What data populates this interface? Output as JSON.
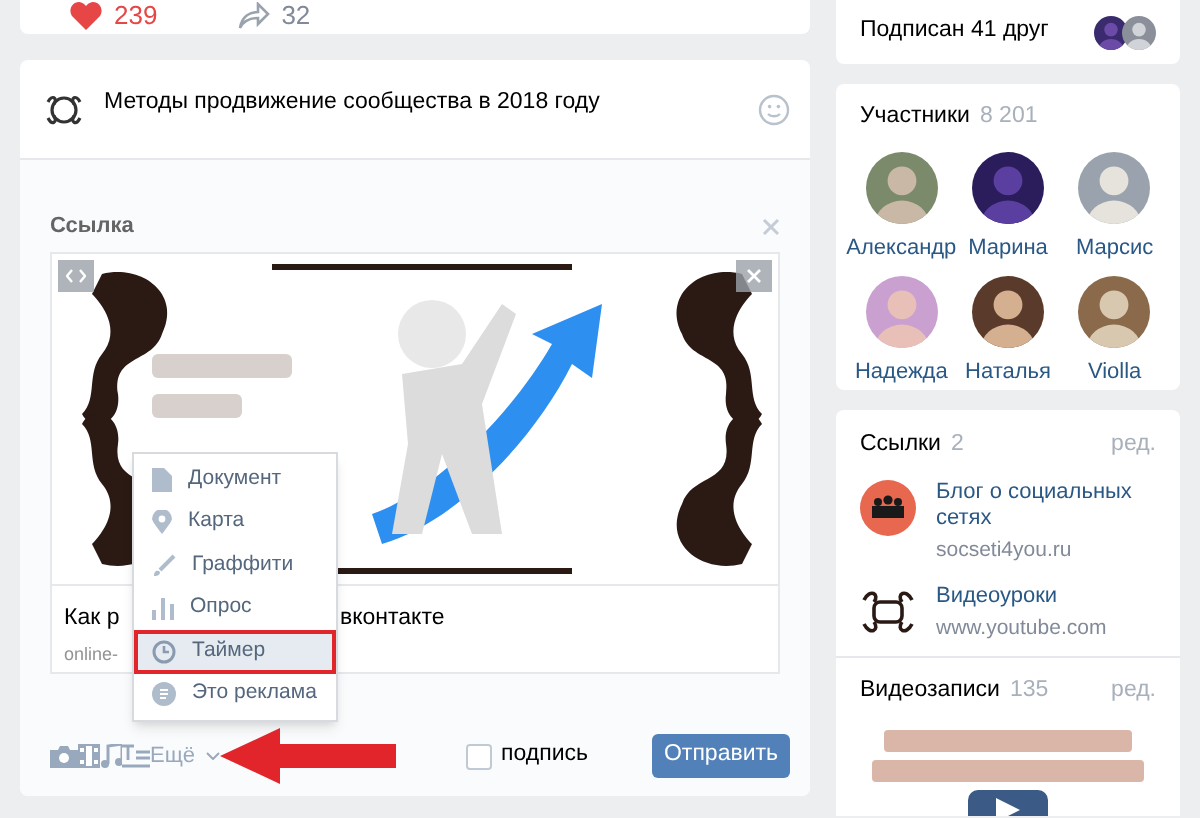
{
  "post_stats": {
    "likes": "239",
    "shares": "32"
  },
  "composer": {
    "text": "Методы продвижение сообщества в 2018 году",
    "attachment": {
      "label": "Ссылка",
      "title_parts": [
        "Как р",
        "вконтакте"
      ],
      "url": "online-"
    },
    "menu": [
      {
        "kind": "document",
        "label": "Документ",
        "selected": false
      },
      {
        "kind": "map",
        "label": "Карта",
        "selected": false
      },
      {
        "kind": "graffiti",
        "label": "Граффити",
        "selected": false
      },
      {
        "kind": "poll",
        "label": "Опрос",
        "selected": false
      },
      {
        "kind": "timer",
        "label": "Таймер",
        "selected": true
      },
      {
        "kind": "ad",
        "label": "Это реклама",
        "selected": false
      }
    ],
    "more_label": "Ещё",
    "signature": {
      "label": "подпись",
      "checked": false
    },
    "send_button": "Отправить"
  },
  "sidebar": {
    "friends": {
      "text": "Подписан 41 друг"
    },
    "members": {
      "title": "Участники",
      "count": "8 201",
      "people": [
        {
          "name": "Александр"
        },
        {
          "name": "Марина"
        },
        {
          "name": "Марсис"
        },
        {
          "name": "Надежда"
        },
        {
          "name": "Наталья"
        },
        {
          "name": "Violla"
        }
      ]
    },
    "links": {
      "title": "Ссылки",
      "count": "2",
      "edit": "ред.",
      "items": [
        {
          "kind": "blog",
          "title": "Блог о социальных сетях",
          "url": "socseti4you.ru"
        },
        {
          "kind": "video",
          "title": "Видеоуроки",
          "url": "www.youtube.com"
        }
      ]
    },
    "videos": {
      "title": "Видеозаписи",
      "count": "135",
      "edit": "ред."
    }
  }
}
